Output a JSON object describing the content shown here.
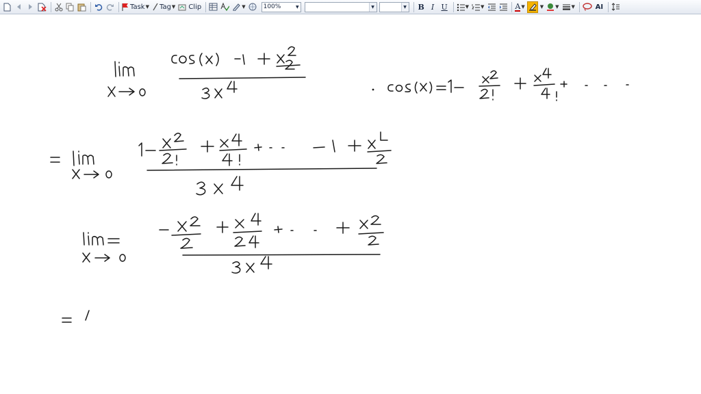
{
  "toolbar": {
    "task_label": "Task",
    "tag_label": "Tag",
    "clip_label": "Clip",
    "zoom_value": "100%",
    "font_name_value": "",
    "font_size_value": "",
    "bold_label": "B",
    "italic_label": "I",
    "underline_label": "U",
    "font_color_label": "A",
    "text_style_label": "AI"
  },
  "colors": {
    "ink": "#1a1a1a",
    "highlight_button_bg": "#f5b400",
    "toolbar_bg_top": "#fbfcfe",
    "toolbar_bg_bottom": "#e4e9f1"
  }
}
